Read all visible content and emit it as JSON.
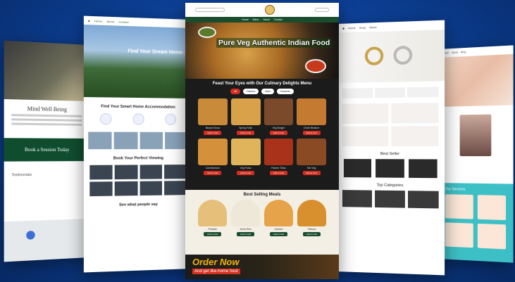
{
  "background": {
    "color": "#0b3d91"
  },
  "card_left": {
    "title": "Mind Well Being",
    "section": "Book a Session Today",
    "testimonials_heading": "Testimonials"
  },
  "card_realestate": {
    "hero_title": "Find Your Dream Home",
    "section_title": "Find Your Smart Home Accommodation",
    "tours_title": "Book Your Perfect Viewing",
    "reviews_title": "See what people say"
  },
  "card_food": {
    "headline": "Pure Veg Authentic Indian Food",
    "menu_heading": "Feast Your Eyes with Our Culinary Delights Menu",
    "best_selling_heading": "Best Selling Meals",
    "order_now": "Order Now",
    "order_sub": "And get like-home food",
    "items": [
      "Biryani Dosa",
      "Spring Rolls",
      "Veg Burger",
      "Chole Bhature",
      "Dal Makhani",
      "Veg Pulao",
      "Paneer Tikka",
      "Mix Veg"
    ],
    "best_items": [
      "Paratha",
      "Jeera Rice",
      "Kachori",
      "Pakora"
    ],
    "pill_labels": [
      "All",
      "Starters",
      "Main",
      "Desserts"
    ],
    "add_label": "Add to Cart",
    "accent_color": "#d62e1f"
  },
  "card_jewelry": {
    "best_seller": "Best Seller",
    "top_categories": "Top Categories"
  },
  "card_baby": {
    "about": "Our Services"
  }
}
